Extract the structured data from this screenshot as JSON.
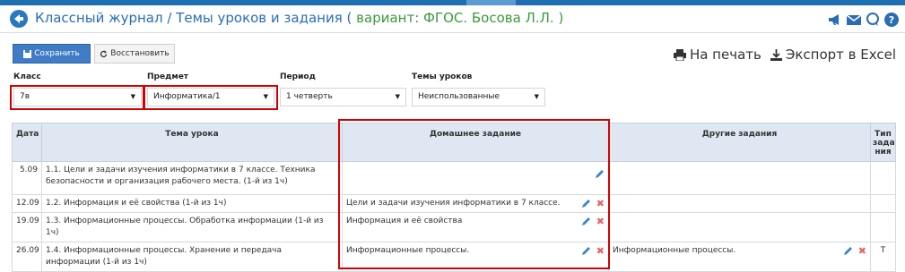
{
  "header": {
    "title": "Классный журнал / Темы уроков и задания (",
    "variant": "вариант: ФГОС. Босова Л.Л. )",
    "icons": [
      "back-arrow-icon",
      "megaphone-icon",
      "envelope-icon",
      "chat-icon",
      "help-icon"
    ]
  },
  "toolbar": {
    "save_label": "Сохранить",
    "restore_label": "Восстановить"
  },
  "links": {
    "print": "На печать",
    "export": "Экспорт в Excel"
  },
  "filters": {
    "class": {
      "label": "Класс",
      "value": "7в"
    },
    "subject": {
      "label": "Предмет",
      "value": "Информатика/1"
    },
    "period": {
      "label": "Период",
      "value": "1 четверть"
    },
    "topics": {
      "label": "Темы уроков",
      "value": "Неиспользованные"
    }
  },
  "table": {
    "headers": {
      "date": "Дата",
      "topic": "Тема урока",
      "homework": "Домашнее задание",
      "other": "Другие задания",
      "type": "Тип зада ния"
    },
    "rows": [
      {
        "date": "5.09",
        "topic": "1.1. Цели и задачи изучения информатики в 7 классе. Техника безопасности и организация рабочего места. (1-й из 1ч)",
        "homework": "",
        "other": "",
        "type": ""
      },
      {
        "date": "12.09",
        "topic": "1.2. Информация и её свойства (1-й из 1ч)",
        "homework": "Цели и задачи изучения информатики в 7 классе.",
        "other": "",
        "type": ""
      },
      {
        "date": "19.09",
        "topic": "1.3. Информационные процессы. Обработка информации (1-й из 1ч)",
        "homework": "Информация и её свойства",
        "other": "",
        "type": ""
      },
      {
        "date": "26.09",
        "topic": "1.4. Информационные процессы. Хранение и передача информации (1-й из 1ч)",
        "homework": "Информационные процессы.",
        "other": "Информационные процессы.",
        "type": "Т"
      }
    ]
  },
  "colors": {
    "accent": "#2a6db5",
    "variant": "#3a9a3a",
    "highlight": "#d40000",
    "header_bg": "#dfe8f2"
  }
}
